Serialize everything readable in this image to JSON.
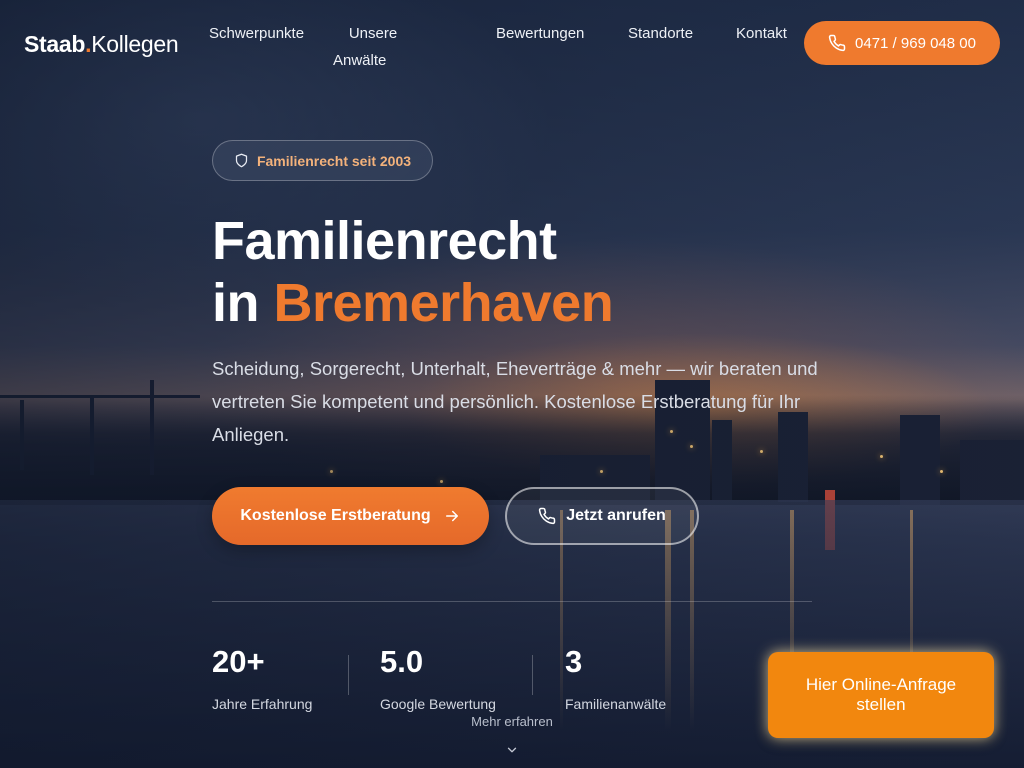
{
  "header": {
    "logo": {
      "part1": "Staab",
      "dot": ".",
      "part2": "Kollegen"
    },
    "nav": {
      "schwerpunkte": "Schwerpunkte",
      "anwaelte_line1": "Unsere",
      "anwaelte_line2": "Anwälte",
      "bewertungen": "Bewertungen",
      "standorte": "Standorte",
      "kontakt": "Kontakt"
    },
    "phone_button": "0471 / 969 048 00",
    "phone_icon": "phone-icon"
  },
  "hero": {
    "badge": "Familienrecht seit 2003",
    "badge_icon": "shield-icon",
    "title_line1": "Familienrecht",
    "title_prefix": "in",
    "title_accent": "Bremerhaven",
    "lead": "Scheidung, Sorgerecht, Unterhalt, Eheverträge & mehr — wir beraten und vertreten Sie kompetent und persönlich. Kostenlose Erstberatung für Ihr Anliegen.",
    "cta_primary": "Kostenlose Erstberatung",
    "cta_primary_icon": "arrow-right-icon",
    "cta_secondary": "Jetzt anrufen",
    "cta_secondary_icon": "phone-icon"
  },
  "stats": [
    {
      "value": "20+",
      "label": "Jahre Erfahrung"
    },
    {
      "value": "5.0",
      "label": "Google Bewertung"
    },
    {
      "value": "3",
      "label": "Familienanwälte"
    }
  ],
  "scroll_hint": {
    "label": "Mehr erfahren",
    "icon": "chevron-down-icon"
  },
  "floating_button": "Hier Online-Anfrage stellen",
  "colors": {
    "accent": "#ef7a2e",
    "floating": "#f2870e",
    "badge_text": "#f3b27b"
  }
}
